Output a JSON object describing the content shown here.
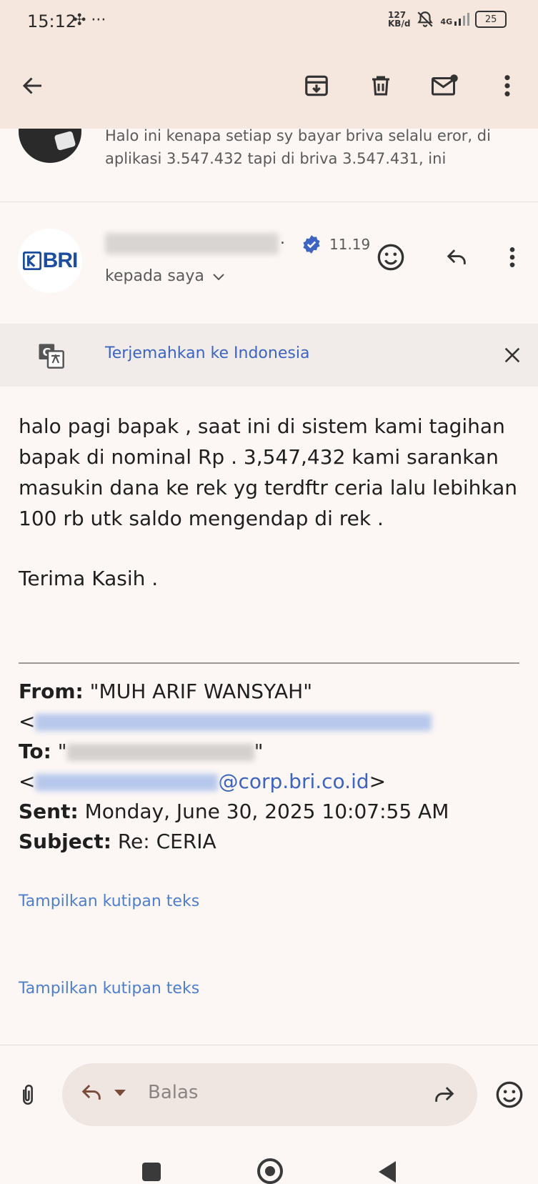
{
  "status_bar": {
    "time": "15:12",
    "extra": "✣ ···",
    "net_speed_top": "127",
    "net_speed_bottom": "KB/d",
    "network": "4G",
    "battery": "25"
  },
  "toolbar": {
    "back_icon": "arrow-left-icon",
    "archive_icon": "archive-icon",
    "delete_icon": "trash-icon",
    "mark_unread_icon": "mail-unread-icon",
    "more_icon": "more-vert-icon"
  },
  "previous_message": {
    "snippet": "Halo ini kenapa setiap sy bayar briva selalu eror, di aplikasi 3.547.432 tapi di briva 3.547.431, ini"
  },
  "message": {
    "sender_suffix": ".",
    "time": "11.19",
    "recipient_label": "kepada saya",
    "verified_color": "#3c64c0",
    "logo_text": "BRI",
    "logo_color": "#1d4e9e"
  },
  "translate_bar": {
    "link": "Terjemahkan ke Indonesia"
  },
  "body": {
    "paragraph1": "halo pagi bapak , saat ini di sistem kami tagihan bapak di nominal Rp . 3,547,432  kami sarankan masukin dana ke rek yg terdftr ceria lalu lebihkan 100 rb utk saldo mengendap di rek .",
    "closing": "Terima Kasih ."
  },
  "quoted_header": {
    "from_label": "From:",
    "from_value": "\"MUH ARIF WANSYAH\"",
    "angle_open": "<",
    "to_label": "To:",
    "to_open_quote": "\"",
    "to_close_quote": "\"",
    "to_email_open": "<",
    "to_email_domain": "@corp.bri.co.id",
    "to_email_close": ">",
    "sent_label": "Sent:",
    "sent_value": "Monday, June 30, 2025 10:07:55 AM",
    "subject_label": "Subject:",
    "subject_value": "Re: CERIA"
  },
  "quote_links": {
    "first": "Tampilkan kutipan teks",
    "second": "Tampilkan kutipan teks"
  },
  "reply_bar": {
    "placeholder": "Balas"
  },
  "colors": {
    "toolbar_bg": "#f5e6de",
    "page_bg": "#fcf7f5",
    "link": "#3c64c0"
  }
}
